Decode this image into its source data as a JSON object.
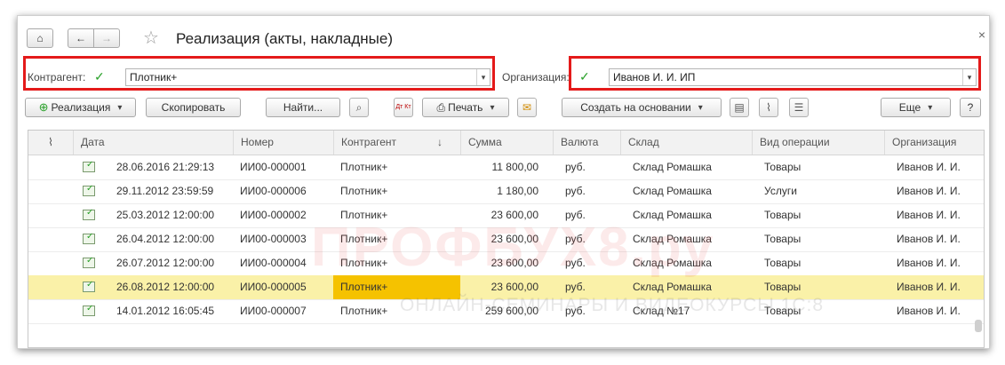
{
  "window": {
    "title": "Реализация (акты, накладные)",
    "close_label": "×"
  },
  "filters": {
    "kontragent_label": "Контрагент:",
    "kontragent_value": "Плотник+",
    "organization_label": "Организация:",
    "organization_value": "Иванов И. И. ИП"
  },
  "toolbar": {
    "realization_label": "Реализация",
    "copy_label": "Скопировать",
    "find_label": "Найти...",
    "print_label": "Печать",
    "create_based_label": "Создать на основании",
    "more_label": "Еще",
    "help_label": "?",
    "dtkt_label": "Дт Кт"
  },
  "table": {
    "columns": [
      "Дата",
      "Номер",
      "Контрагент",
      "Сумма",
      "Валюта",
      "Склад",
      "Вид операции",
      "Организация"
    ],
    "sort_indicator": "↓",
    "rows": [
      {
        "date": "28.06.2016 21:29:13",
        "number": "ИИ00-000001",
        "kontragent": "Плотник+",
        "sum": "11 800,00",
        "currency": "руб.",
        "warehouse": "Склад Ромашка",
        "operation": "Товары",
        "organization": "Иванов И. И."
      },
      {
        "date": "29.11.2012 23:59:59",
        "number": "ИИ00-000006",
        "kontragent": "Плотник+",
        "sum": "1 180,00",
        "currency": "руб.",
        "warehouse": "Склад Ромашка",
        "operation": "Услуги",
        "organization": "Иванов И. И."
      },
      {
        "date": "25.03.2012 12:00:00",
        "number": "ИИ00-000002",
        "kontragent": "Плотник+",
        "sum": "23 600,00",
        "currency": "руб.",
        "warehouse": "Склад Ромашка",
        "operation": "Товары",
        "organization": "Иванов И. И."
      },
      {
        "date": "26.04.2012 12:00:00",
        "number": "ИИ00-000003",
        "kontragent": "Плотник+",
        "sum": "23 600,00",
        "currency": "руб.",
        "warehouse": "Склад Ромашка",
        "operation": "Товары",
        "organization": "Иванов И. И."
      },
      {
        "date": "26.07.2012 12:00:00",
        "number": "ИИ00-000004",
        "kontragent": "Плотник+",
        "sum": "23 600,00",
        "currency": "руб.",
        "warehouse": "Склад Ромашка",
        "operation": "Товары",
        "organization": "Иванов И. И."
      },
      {
        "date": "26.08.2012 12:00:00",
        "number": "ИИ00-000005",
        "kontragent": "Плотник+",
        "sum": "23 600,00",
        "currency": "руб.",
        "warehouse": "Склад Ромашка",
        "operation": "Товары",
        "organization": "Иванов И. И."
      },
      {
        "date": "14.01.2012 16:05:45",
        "number": "ИИ00-000007",
        "kontragent": "Плотник+",
        "sum": "259 600,00",
        "currency": "руб.",
        "warehouse": "Склад №17",
        "operation": "Товары",
        "organization": "Иванов И. И."
      }
    ],
    "selected_row_index": 5
  },
  "watermark": {
    "main": "ПРОФБУХ8.ру",
    "sub": "ОНЛАЙН-СЕМИНАРЫ И ВИДЕОКУРСЫ 1С:8"
  },
  "colors": {
    "highlight_frame": "#e41a1a",
    "selected_row": "#faf1a8",
    "selected_cell": "#f5c200",
    "check": "#2aa12a"
  }
}
